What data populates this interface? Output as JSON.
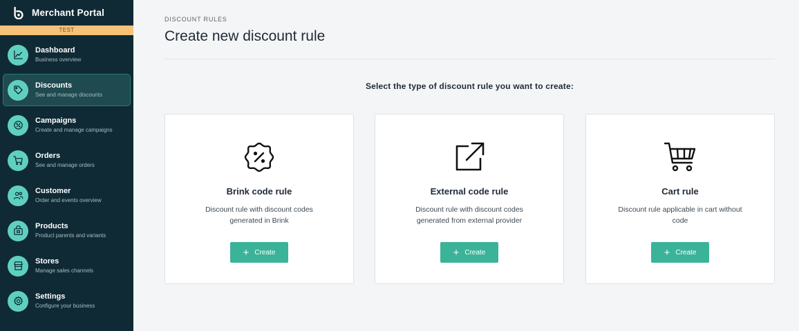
{
  "app": {
    "title": "Merchant Portal",
    "environment": "TEST"
  },
  "sidebar": {
    "items": [
      {
        "label": "Dashboard",
        "sub": "Business overview",
        "icon": "chart-line-icon"
      },
      {
        "label": "Discounts",
        "sub": "See and manage discounts",
        "icon": "tag-icon",
        "active": true
      },
      {
        "label": "Campaigns",
        "sub": "Create and manage campaigns",
        "icon": "percent-badge-icon"
      },
      {
        "label": "Orders",
        "sub": "See and manage orders",
        "icon": "cart-icon"
      },
      {
        "label": "Customer",
        "sub": "Order and events overview",
        "icon": "users-icon"
      },
      {
        "label": "Products",
        "sub": "Product parents and variants",
        "icon": "bag-icon"
      },
      {
        "label": "Stores",
        "sub": "Manage sales channels",
        "icon": "store-icon"
      },
      {
        "label": "Settings",
        "sub": "Configure your business",
        "icon": "gear-icon"
      }
    ]
  },
  "main": {
    "breadcrumb": "DISCOUNT RULES",
    "title": "Create new discount rule",
    "prompt": "Select the type of discount rule you want to create:",
    "cards": [
      {
        "title": "Brink code rule",
        "description": "Discount rule with discount codes generated in Brink",
        "button": "Create",
        "icon": "percent-badge-icon"
      },
      {
        "title": "External code rule",
        "description": "Discount rule with discount codes generated from external provider",
        "button": "Create",
        "icon": "external-link-icon"
      },
      {
        "title": "Cart rule",
        "description": "Discount rule applicable in cart without code",
        "button": "Create",
        "icon": "cart-icon"
      }
    ]
  },
  "colors": {
    "sidebar_bg": "#0f2a35",
    "accent": "#3bb398",
    "nav_icon_bg": "#5fd0c0",
    "env_badge": "#f6c27a"
  }
}
